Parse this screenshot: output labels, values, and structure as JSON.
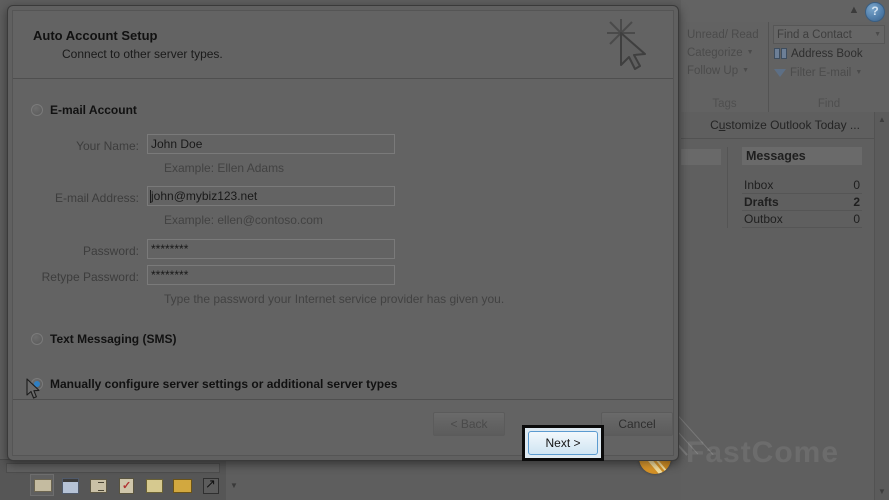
{
  "dialog": {
    "title": "Auto Account Setup",
    "subtitle": "Connect to other server types.",
    "logo_icon": "cursor-sparkle-icon",
    "options": [
      {
        "label": "E-mail Account",
        "checked": false
      },
      {
        "label": "Text Messaging (SMS)",
        "checked": false
      },
      {
        "label": "Manually configure server settings or additional server types",
        "checked": true
      }
    ],
    "fields": [
      {
        "label": "Your Name:",
        "value": "John Doe",
        "placeholder": "",
        "hint": "Example: Ellen Adams"
      },
      {
        "label": "E-mail Address:",
        "value": "john@mybiz123.net",
        "placeholder": "",
        "hint": "Example: ellen@contoso.com"
      },
      {
        "label": "Password:",
        "value": "********",
        "placeholder": "",
        "hint": ""
      },
      {
        "label": "Retype Password:",
        "value": "********",
        "placeholder": "",
        "hint": "Type the password your Internet service provider has given you."
      }
    ],
    "buttons": {
      "back": "< Back",
      "next": "Next >",
      "cancel": "Cancel"
    }
  },
  "ribbon": {
    "help_label": "?",
    "collapse_icon": "chevron-up-icon",
    "groups": [
      {
        "name": "Tags",
        "items": [
          {
            "label": "Unread/ Read",
            "caret": false
          },
          {
            "label": "Categorize",
            "caret": true
          },
          {
            "label": "Follow Up",
            "caret": true
          }
        ]
      },
      {
        "name": "Find",
        "items": [
          {
            "label": "Find a Contact",
            "caret": true
          },
          {
            "label": "Address Book",
            "caret": false,
            "icon": "address-book-icon"
          },
          {
            "label": "Filter E-mail",
            "caret": true,
            "icon": "funnel-icon"
          }
        ]
      }
    ]
  },
  "outlook_today": {
    "customize_prefix": "C",
    "customize_underline": "u",
    "customize_suffix": "stomize Outlook Today ...",
    "messages_title": "Messages",
    "rows": [
      {
        "name": "Inbox",
        "count": "0",
        "bold": false
      },
      {
        "name": "Drafts",
        "count": "2",
        "bold": true
      },
      {
        "name": "Outbox",
        "count": "0",
        "bold": false
      }
    ]
  },
  "navbar": {
    "icons": [
      {
        "name": "mail-icon",
        "selected": true
      },
      {
        "name": "calendar-icon",
        "selected": false
      },
      {
        "name": "contacts-icon",
        "selected": false
      },
      {
        "name": "tasks-icon",
        "selected": false
      },
      {
        "name": "notes-icon",
        "selected": false
      },
      {
        "name": "folder-list-icon",
        "selected": false
      },
      {
        "name": "shortcuts-icon",
        "selected": false
      }
    ],
    "more_icon": "chevron-down-icon"
  },
  "watermark": {
    "text": "FastCome"
  },
  "colors": {
    "accent_blue": "#2f7fc2",
    "dialog_bg": "#606060",
    "highlight_ring": "#0b0b0b",
    "badge_orange": "#e09a2a"
  }
}
